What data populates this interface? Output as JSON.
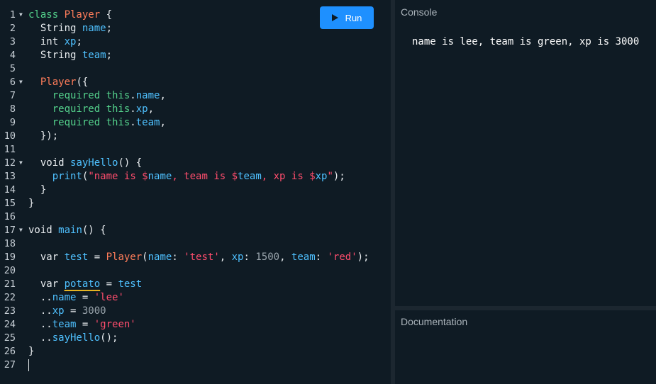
{
  "run_button": {
    "label": "Run"
  },
  "console": {
    "title": "Console",
    "output": "name is lee, team is green, xp is 3000"
  },
  "documentation": {
    "title": "Documentation"
  },
  "editor": {
    "lines": [
      {
        "n": "1",
        "fold": true,
        "tokens": [
          [
            "k",
            "class "
          ],
          [
            "c",
            "Player"
          ],
          [
            "p",
            " {"
          ]
        ]
      },
      {
        "n": "2",
        "fold": false,
        "tokens": [
          [
            "p",
            "  String "
          ],
          [
            "i",
            "name"
          ],
          [
            "p",
            ";"
          ]
        ]
      },
      {
        "n": "3",
        "fold": false,
        "tokens": [
          [
            "p",
            "  int "
          ],
          [
            "i",
            "xp"
          ],
          [
            "p",
            ";"
          ]
        ]
      },
      {
        "n": "4",
        "fold": false,
        "tokens": [
          [
            "p",
            "  String "
          ],
          [
            "i",
            "team"
          ],
          [
            "p",
            ";"
          ]
        ]
      },
      {
        "n": "5",
        "fold": false,
        "tokens": []
      },
      {
        "n": "6",
        "fold": true,
        "tokens": [
          [
            "p",
            "  "
          ],
          [
            "c",
            "Player"
          ],
          [
            "p",
            "({"
          ]
        ]
      },
      {
        "n": "7",
        "fold": false,
        "tokens": [
          [
            "p",
            "    "
          ],
          [
            "k",
            "required this"
          ],
          [
            "p",
            "."
          ],
          [
            "i",
            "name"
          ],
          [
            "p",
            ","
          ]
        ]
      },
      {
        "n": "8",
        "fold": false,
        "tokens": [
          [
            "p",
            "    "
          ],
          [
            "k",
            "required this"
          ],
          [
            "p",
            "."
          ],
          [
            "i",
            "xp"
          ],
          [
            "p",
            ","
          ]
        ]
      },
      {
        "n": "9",
        "fold": false,
        "tokens": [
          [
            "p",
            "    "
          ],
          [
            "k",
            "required this"
          ],
          [
            "p",
            "."
          ],
          [
            "i",
            "team"
          ],
          [
            "p",
            ","
          ]
        ]
      },
      {
        "n": "10",
        "fold": false,
        "tokens": [
          [
            "p",
            "  });"
          ]
        ]
      },
      {
        "n": "11",
        "fold": false,
        "tokens": []
      },
      {
        "n": "12",
        "fold": true,
        "tokens": [
          [
            "p",
            "  void "
          ],
          [
            "i",
            "sayHello"
          ],
          [
            "p",
            "() {"
          ]
        ]
      },
      {
        "n": "13",
        "fold": false,
        "tokens": [
          [
            "p",
            "    "
          ],
          [
            "i",
            "print"
          ],
          [
            "p",
            "("
          ],
          [
            "s",
            "\"name is $"
          ],
          [
            "i",
            "name"
          ],
          [
            "s",
            ", team is $"
          ],
          [
            "i",
            "team"
          ],
          [
            "s",
            ", xp is $"
          ],
          [
            "i",
            "xp"
          ],
          [
            "s",
            "\""
          ],
          [
            "p",
            ");"
          ]
        ]
      },
      {
        "n": "14",
        "fold": false,
        "tokens": [
          [
            "p",
            "  }"
          ]
        ]
      },
      {
        "n": "15",
        "fold": false,
        "tokens": [
          [
            "p",
            "}"
          ]
        ]
      },
      {
        "n": "16",
        "fold": false,
        "tokens": []
      },
      {
        "n": "17",
        "fold": true,
        "tokens": [
          [
            "p",
            "void "
          ],
          [
            "i",
            "main"
          ],
          [
            "p",
            "() {"
          ]
        ]
      },
      {
        "n": "18",
        "fold": false,
        "tokens": []
      },
      {
        "n": "19",
        "fold": false,
        "tokens": [
          [
            "p",
            "  var "
          ],
          [
            "i",
            "test"
          ],
          [
            "p",
            " = "
          ],
          [
            "c",
            "Player"
          ],
          [
            "p",
            "("
          ],
          [
            "i",
            "name"
          ],
          [
            "p",
            ": "
          ],
          [
            "s",
            "'test'"
          ],
          [
            "p",
            ", "
          ],
          [
            "i",
            "xp"
          ],
          [
            "p",
            ": "
          ],
          [
            "n",
            "1500"
          ],
          [
            "p",
            ", "
          ],
          [
            "i",
            "team"
          ],
          [
            "p",
            ": "
          ],
          [
            "s",
            "'red'"
          ],
          [
            "p",
            ");"
          ]
        ]
      },
      {
        "n": "20",
        "fold": false,
        "tokens": []
      },
      {
        "n": "21",
        "fold": false,
        "tokens": [
          [
            "p",
            "  var "
          ],
          [
            "i warn",
            "potato"
          ],
          [
            "p",
            " = "
          ],
          [
            "i",
            "test"
          ]
        ]
      },
      {
        "n": "22",
        "fold": false,
        "tokens": [
          [
            "p",
            "  .."
          ],
          [
            "i",
            "name"
          ],
          [
            "p",
            " = "
          ],
          [
            "s",
            "'lee'"
          ]
        ]
      },
      {
        "n": "23",
        "fold": false,
        "tokens": [
          [
            "p",
            "  .."
          ],
          [
            "i",
            "xp"
          ],
          [
            "p",
            " = "
          ],
          [
            "n",
            "3000"
          ]
        ]
      },
      {
        "n": "24",
        "fold": false,
        "tokens": [
          [
            "p",
            "  .."
          ],
          [
            "i",
            "team"
          ],
          [
            "p",
            " = "
          ],
          [
            "s",
            "'green'"
          ]
        ]
      },
      {
        "n": "25",
        "fold": false,
        "tokens": [
          [
            "p",
            "  .."
          ],
          [
            "i",
            "sayHello"
          ],
          [
            "p",
            "();"
          ]
        ]
      },
      {
        "n": "26",
        "fold": false,
        "tokens": [
          [
            "p",
            "}"
          ]
        ]
      },
      {
        "n": "27",
        "fold": false,
        "tokens": [],
        "cursor": true
      }
    ]
  }
}
